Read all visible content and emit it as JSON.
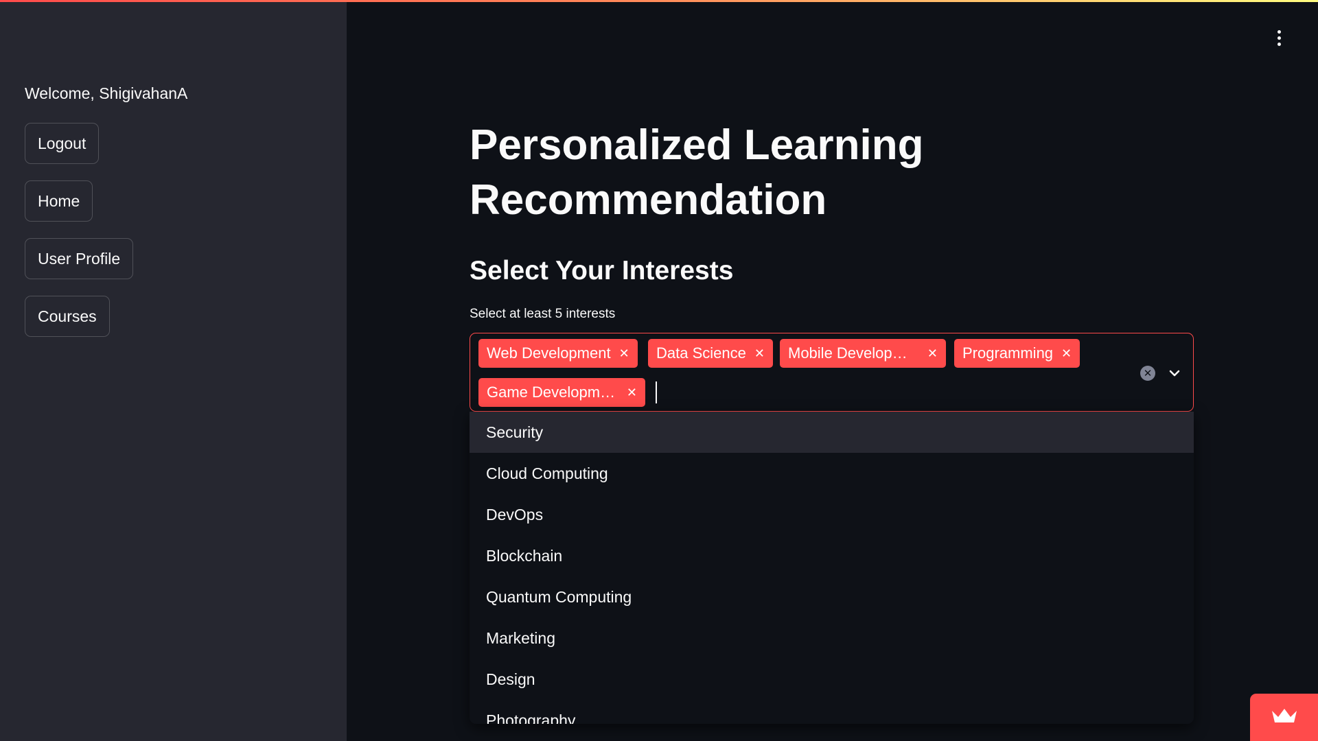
{
  "sidebar": {
    "welcome_text": "Welcome, ShigivahanA",
    "buttons": [
      "Logout",
      "Home",
      "User Profile",
      "Courses"
    ]
  },
  "main": {
    "title": "Personalized Learning Recommendation",
    "section_heading": "Select Your Interests",
    "interests": {
      "label": "Select at least 5 interests",
      "selected": [
        "Web Development",
        "Data Science",
        "Mobile Develop…",
        "Programming",
        "Game Developm…"
      ],
      "options": [
        "Security",
        "Cloud Computing",
        "DevOps",
        "Blockchain",
        "Quantum Computing",
        "Marketing",
        "Design",
        "Photography"
      ],
      "highlighted_option": "Security"
    }
  },
  "icons": {
    "menu": "vertical-ellipsis-icon",
    "chip_remove": "close-icon",
    "clear_all": "clear-circle-icon",
    "dropdown": "chevron-down-icon",
    "badge": "crown-icon"
  },
  "colors": {
    "accent": "#ff4b4b",
    "background": "#0e1117",
    "sidebar": "#262730",
    "text": "#fafafa"
  }
}
